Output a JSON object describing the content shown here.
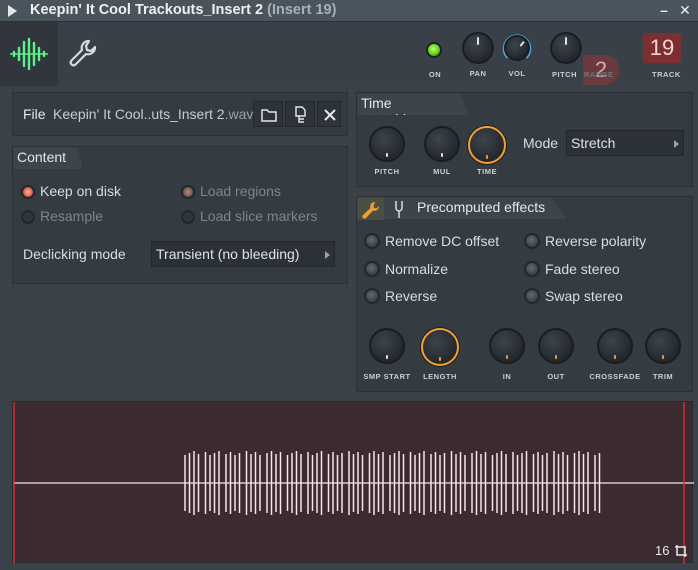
{
  "window": {
    "title": "Keepin' It Cool Trackouts_Insert 2",
    "subtitle": "(Insert 19)",
    "minimize_glyph": "–",
    "close_glyph": "✕",
    "menu_icon": "triangle-right-icon"
  },
  "header": {
    "tabs": [
      {
        "icon": "waveform-icon"
      },
      {
        "icon": "wrench-icon"
      }
    ],
    "controls": {
      "on_label": "ON",
      "pan_label": "PAN",
      "vol_label": "VOL",
      "pitch_label": "PITCH",
      "range_label": "RANGE",
      "range_value": "2",
      "track_label": "TRACK",
      "track_value": "19"
    },
    "colors": {
      "on_led": "#5dd21c",
      "vol_ring": "#4aa8e0",
      "track_bg": "#7d2e30",
      "range_bg": "#6b3a3f"
    }
  },
  "file": {
    "label": "File",
    "name": "Keepin' It Cool..uts_Insert 2",
    "ext": ".wav",
    "buttons": [
      "folder-open-icon",
      "file-tree-icon",
      "close-icon"
    ]
  },
  "content": {
    "title": "Content",
    "options": {
      "keep_on_disk": "Keep on disk",
      "resample": "Resample",
      "load_regions": "Load regions",
      "load_slice_markers": "Load slice markers"
    },
    "declicking_label": "Declicking mode",
    "declicking_value": "Transient (no bleeding)"
  },
  "time_stretching": {
    "title": "Time stretching",
    "pitch_label": "PITCH",
    "mul_label": "MUL",
    "time_label": "TIME",
    "mode_label": "Mode",
    "mode_value": "Stretch",
    "accent": "#f0a030"
  },
  "precomputed": {
    "title": "Precomputed effects",
    "switches": {
      "remove_dc": "Remove DC offset",
      "normalize": "Normalize",
      "reverse": "Reverse",
      "reverse_polarity": "Reverse polarity",
      "fade_stereo": "Fade stereo",
      "swap_stereo": "Swap stereo"
    },
    "knobs": {
      "smp_start": "SMP START",
      "length": "LENGTH",
      "in": "IN",
      "out": "OUT",
      "crossfade": "CROSSFADE",
      "trim": "TRIM"
    }
  },
  "waveform": {
    "zoom_value": "16",
    "zoom_icon": "crop-icon",
    "bg_color": "#3b2a2f",
    "wave_color": "#f4e6ea",
    "marker_color": "#d23030"
  }
}
